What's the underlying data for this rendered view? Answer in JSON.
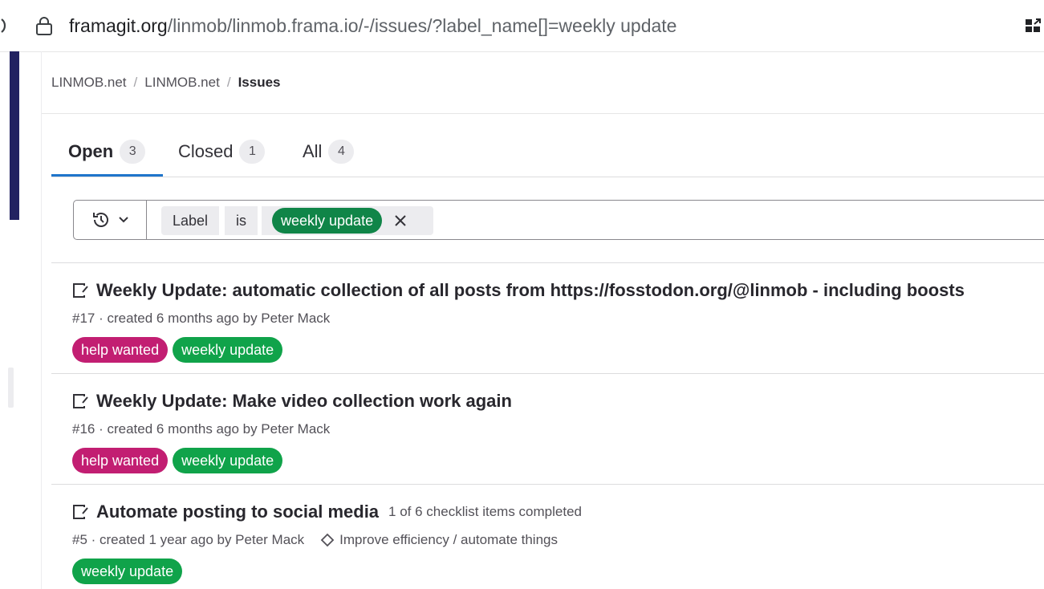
{
  "browser": {
    "url_host": "framagit.org",
    "url_path": "/linmob/linmob.frama.io/-/issues/?label_name[]=weekly update"
  },
  "breadcrumb": {
    "items": [
      "LINMOB.net",
      "LINMOB.net"
    ],
    "current": "Issues",
    "separator": "/"
  },
  "tabs": [
    {
      "label": "Open",
      "count": "3"
    },
    {
      "label": "Closed",
      "count": "1"
    },
    {
      "label": "All",
      "count": "4"
    }
  ],
  "filter": {
    "token_label": "Label",
    "token_operator": "is",
    "token_value": "weekly update",
    "value_color": "#108548"
  },
  "issues": [
    {
      "title": "Weekly Update: automatic collection of all posts from https://fosstodon.org/@linmob - including boosts",
      "meta": "#17 · created 6 months ago by Peter Mack",
      "labels": [
        "help wanted",
        "weekly update"
      ]
    },
    {
      "title": "Weekly Update: Make video collection work again",
      "meta": "#16 · created 6 months ago by Peter Mack",
      "labels": [
        "help wanted",
        "weekly update"
      ]
    },
    {
      "title": "Automate posting to social media",
      "checklist": "1 of 6 checklist items completed",
      "meta": "#5 · created 1 year ago by Peter Mack",
      "milestone": "Improve efficiency / automate things",
      "labels": [
        "weekly update"
      ]
    }
  ],
  "colors": {
    "help_wanted": "#c21e72",
    "weekly_update": "#10a34a",
    "tab_active_underline": "#1f75cb",
    "sidebar_dark": "#222261"
  },
  "icons": [
    "lock-icon",
    "issue-open-icon",
    "history-icon",
    "chevron-down-icon",
    "close-icon",
    "milestone-icon"
  ]
}
